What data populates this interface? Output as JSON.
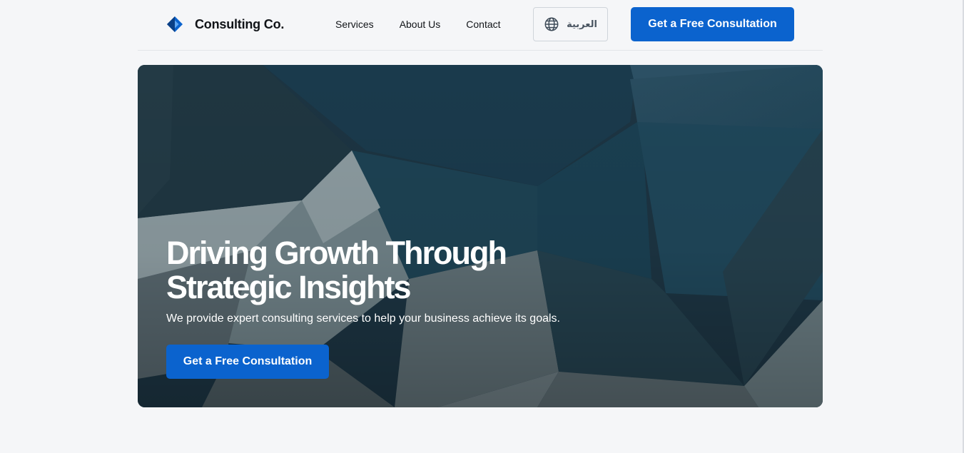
{
  "header": {
    "logo": {
      "icon": "diamond-logo-icon",
      "text": "Consulting Co."
    },
    "nav": [
      {
        "label": "Services"
      },
      {
        "label": "About Us"
      },
      {
        "label": "Contact"
      }
    ],
    "language_button": {
      "icon": "globe-icon",
      "label": "العربية"
    },
    "cta_label": "Get a Free Consultation"
  },
  "hero": {
    "title": "Driving Growth Through Strategic Insights",
    "subtitle": "We provide expert consulting services to help your business achieve its goals.",
    "cta_label": "Get a Free Consultation"
  },
  "colors": {
    "accent": "#0b63ce",
    "page_background": "#f5f6f8",
    "hero_dark": "#1e3745",
    "text_dark": "#111418"
  }
}
